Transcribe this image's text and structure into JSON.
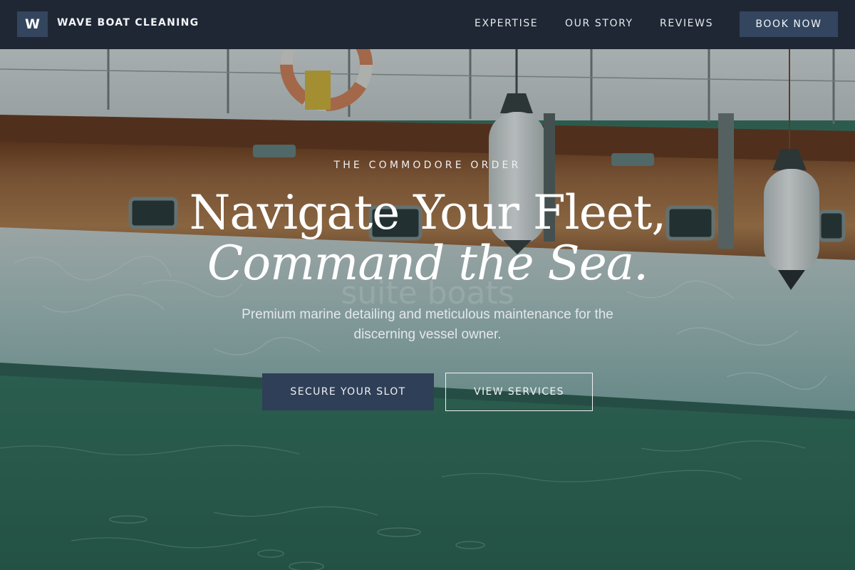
{
  "header": {
    "logo_letter": "W",
    "brand": "WAVE BOAT CLEANING",
    "nav": {
      "expertise": "EXPERTISE",
      "our_story": "OUR STORY",
      "reviews": "REVIEWS"
    },
    "cta": "BOOK NOW"
  },
  "hero": {
    "eyebrow": "THE COMMODORE ORDER",
    "headline_line1": "Navigate Your Fleet,",
    "headline_line2": "Command the Sea.",
    "ghost_text": "suite boats",
    "subtitle": "Premium marine detailing and meticulous maintenance for the discerning vessel owner.",
    "primary_cta": "SECURE YOUR SLOT",
    "secondary_cta": "VIEW SERVICES"
  },
  "colors": {
    "header_bg": "#1f2734",
    "button_navy": "#2f3f57",
    "hull_white": "#dfe4e3",
    "teak_wood": "#8a4f2a",
    "water_green": "#3f7f68"
  }
}
